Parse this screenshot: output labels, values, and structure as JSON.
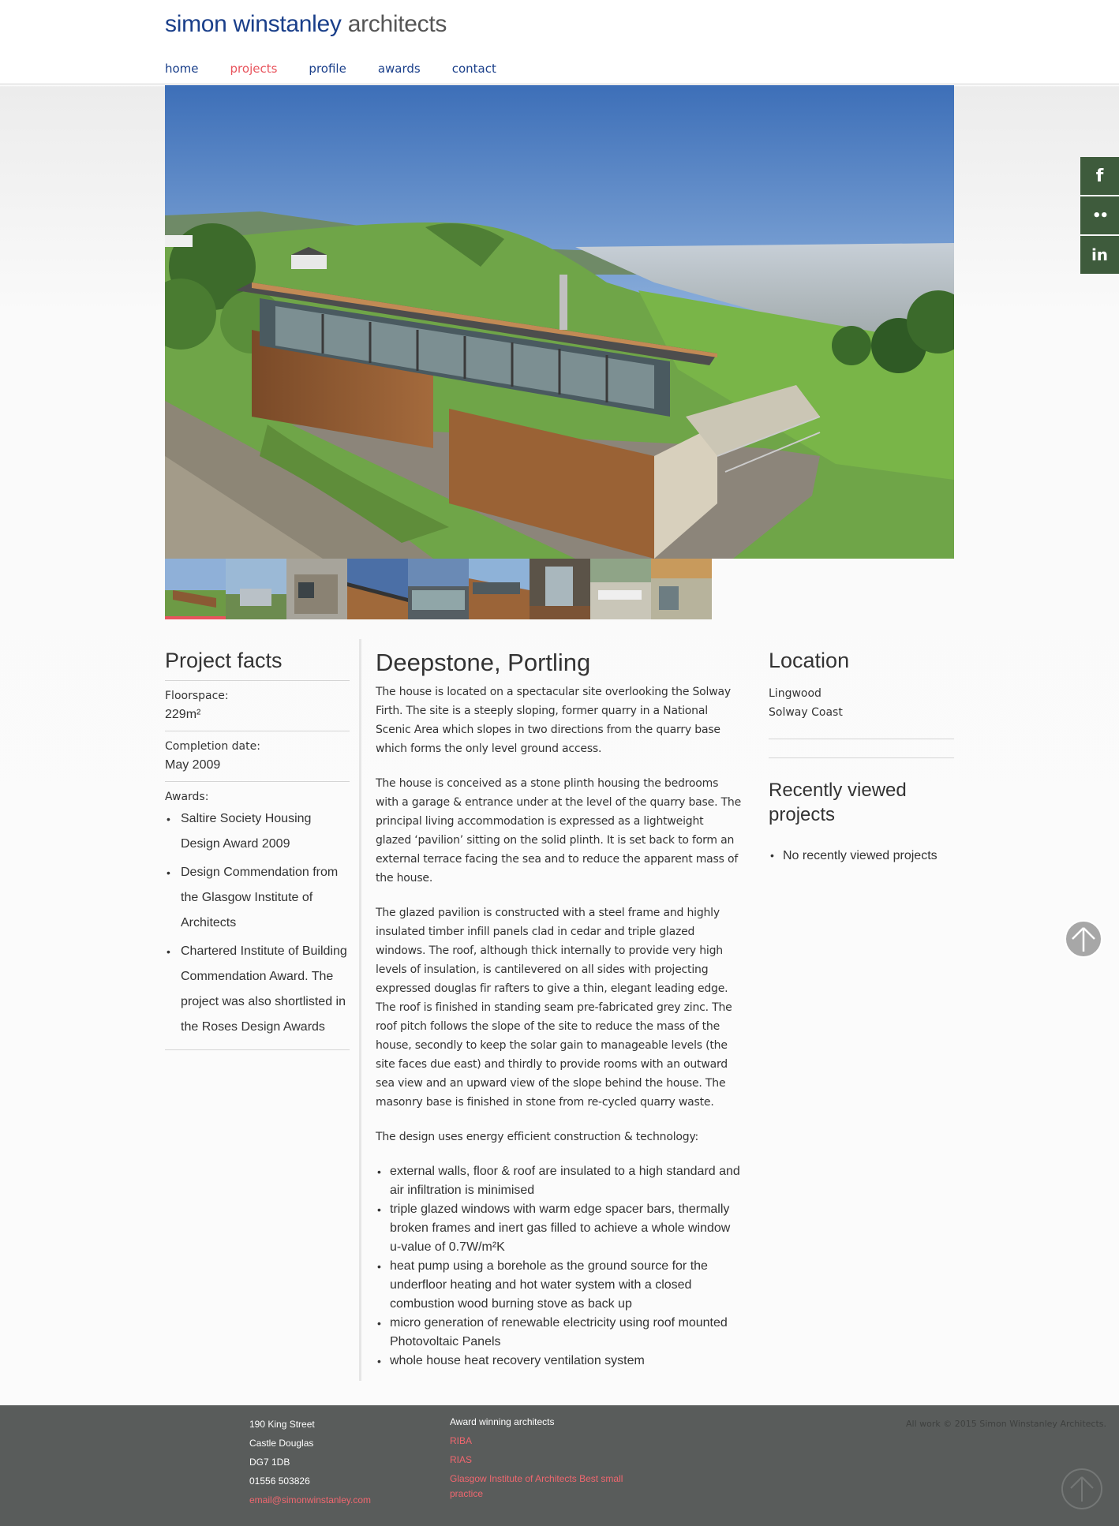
{
  "header": {
    "logo_part1": "simon winstanley",
    "logo_part2": "architects",
    "nav": [
      "home",
      "projects",
      "profile",
      "awards",
      "contact"
    ],
    "active_nav": "projects"
  },
  "social": [
    "f",
    "••",
    "in"
  ],
  "facts": {
    "title": "Project facts",
    "floorspace_label": "Floorspace:",
    "floorspace_value": "229m²",
    "completion_label": "Completion date:",
    "completion_value": "May 2009",
    "awards_label": "Awards:",
    "awards": [
      "Saltire Society Housing Design Award 2009",
      "Design Commendation from the Glasgow Institute of Architects",
      "Chartered Institute of Building Commendation Award. The project was also shortlisted in the Roses Design Awards"
    ]
  },
  "project": {
    "title": "Deepstone, Portling",
    "p1": "The house is located on a spectacular site overlooking the Solway Firth. The site is a steeply sloping, former quarry in a National Scenic Area which slopes in two directions from the quarry base which forms the only level ground access.",
    "p2": "The house is conceived as a stone plinth housing the bedrooms with a garage & entrance under at the level of the quarry base. The principal living accommodation is expressed as a lightweight glazed ‘pavilion’ sitting on the solid plinth. It is set back to form an external terrace facing the sea and to reduce the apparent mass of the house.",
    "p3": "The glazed pavilion is constructed with a steel frame and highly insulated timber infill panels clad in cedar and triple glazed windows. The roof, although thick internally to provide very high levels of insulation, is cantilevered on all sides with projecting expressed douglas fir rafters to give a thin, elegant leading edge. The roof is finished in standing seam pre-fabricated grey zinc. The roof pitch follows the slope of the site to reduce the mass of the house, secondly to keep the solar gain to manageable levels (the site faces due east) and thirdly to provide rooms with an outward sea view and an upward view of the slope behind the house. The masonry base is finished in stone from re-cycled quarry waste.",
    "p4": "The design uses energy efficient construction & technology:",
    "bullets": [
      "external walls, floor & roof are insulated to a high standard and air infiltration is minimised",
      "triple glazed windows with warm edge spacer bars, thermally broken frames and inert gas filled to achieve a whole window u-value of 0.7W/m²K",
      "heat pump using a borehole as the ground source for the underfloor heating and hot water system with a closed combustion wood burning stove as back up",
      "micro generation of renewable electricity using roof mounted Photovoltaic Panels",
      "whole house heat recovery ventilation system"
    ]
  },
  "location": {
    "title": "Location",
    "line1": "Lingwood",
    "line2": "Solway Coast",
    "recent_title": "Recently viewed projects",
    "recent_empty": "No recently viewed projects"
  },
  "footer": {
    "address": [
      "190 King Street",
      "Castle Douglas",
      "DG7 1DB",
      "01556 503826"
    ],
    "email": "email@simonwinstanley.com",
    "awards_heading": "Award winning architects",
    "award_links": [
      "RIBA",
      "RIAS",
      "Glasgow Institute of Architects Best small practice"
    ],
    "copyright": "All work © 2015 Simon Winstanley Architects."
  }
}
